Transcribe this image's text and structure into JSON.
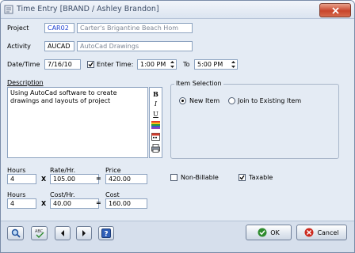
{
  "window": {
    "title": "Time Entry [BRAND / Ashley Brandon]"
  },
  "project": {
    "label": "Project",
    "code": "CAR02",
    "name": "Carter's Brigantine Beach Hom"
  },
  "activity": {
    "label": "Activity",
    "code": "AUCAD",
    "name": "AutoCad Drawings"
  },
  "datetime": {
    "label": "Date/Time",
    "date": "7/16/10",
    "enter_time_label": "Enter Time:",
    "start": "1:00 PM",
    "to_label": "To",
    "end": "5:00 PM"
  },
  "description": {
    "label": "Description",
    "text": "Using AutoCad software to create drawings and layouts of project"
  },
  "item_selection": {
    "title": "Item Selection",
    "new_item": "New Item",
    "join_existing": "Join to Existing Item",
    "selected": "new"
  },
  "billing": {
    "hours_label": "Hours",
    "rate_label": "Rate/Hr.",
    "price_label": "Price",
    "hours": "4",
    "rate": "105.00",
    "price": "420.00",
    "cost_hours_label": "Hours",
    "cost_rate_label": "Cost/Hr.",
    "cost_label": "Cost",
    "cost_hours": "4",
    "cost_rate": "40.00",
    "cost": "160.00",
    "times": "X",
    "equals": "="
  },
  "options": {
    "non_billable": "Non-Billable",
    "non_billable_checked": false,
    "taxable": "Taxable",
    "taxable_checked": true
  },
  "buttons": {
    "ok": "OK",
    "cancel": "Cancel"
  },
  "colors": {
    "code_text": "#1a3ed0",
    "desc_text": "#7d8796"
  }
}
